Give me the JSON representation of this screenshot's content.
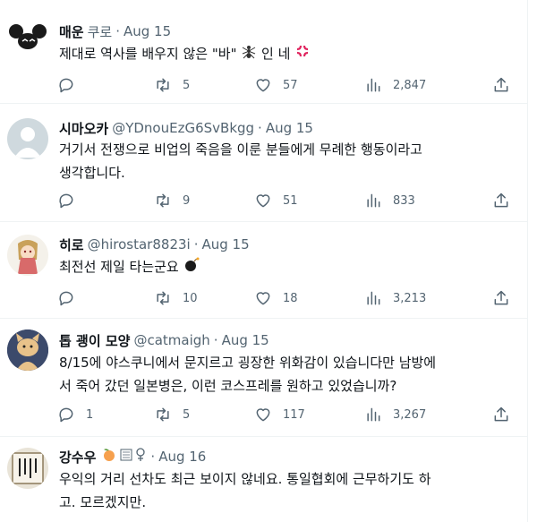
{
  "tweets": [
    {
      "name": "매운",
      "handle": "쿠로",
      "sep": "·",
      "date": "Aug 15",
      "text": "제대로 역사를 배우지 않은 \"바\"",
      "text_suffix": "인 네",
      "reply": "",
      "retweet": "5",
      "like": "57",
      "views": "2,847",
      "avatar_icon": "mouse-ears-avatar",
      "emoji": [
        "ant-icon",
        "anger-icon"
      ]
    },
    {
      "name": "시마오카",
      "handle": "@YDnouEzG6SvBkgg",
      "sep": "·",
      "date": "Aug 15",
      "text_lines": [
        "거기서 전쟁으로 비업의 죽음을 이룬 분들에게 무례한 행동이라고",
        "생각합니다."
      ],
      "reply": "",
      "retweet": "9",
      "like": "51",
      "views": "833",
      "avatar_icon": "default-user-avatar"
    },
    {
      "name": "히로",
      "handle": "@hirostar8823i",
      "sep": "·",
      "date": "Aug 15",
      "text": "최전선 제일 타는군요",
      "reply": "",
      "retweet": "10",
      "like": "18",
      "views": "3,213",
      "avatar_icon": "anime-character-avatar",
      "emoji": [
        "bomb-icon"
      ]
    },
    {
      "name": "톱 괭이 모양",
      "handle": "@catmaigh",
      "sep": "·",
      "date": "Aug 15",
      "text_lines": [
        "8/15에 야스쿠니에서 문지르고 굉장한 위화감이 있습니다만 남방에",
        "서 죽어 갔던 일본병은, 이런 코스프레를 원하고 있었습니까?"
      ],
      "reply": "1",
      "retweet": "5",
      "like": "117",
      "views": "3,267",
      "avatar_icon": "cat-avatar"
    },
    {
      "name": "강수우",
      "handle": "",
      "sep": "·",
      "date": "Aug 16",
      "text_lines": [
        "우익의 거리 선차도 최근 보이지 않네요. 통일협회에 근무하기도 하",
        "고. 모르겠지만."
      ],
      "avatar_icon": "calligraphy-avatar",
      "emoji": [
        "peach-icon",
        "box-icon",
        "female-sign-icon"
      ]
    }
  ],
  "colors": {
    "text": "#0f1419",
    "secondary": "#536471",
    "border": "#eff3f4"
  }
}
